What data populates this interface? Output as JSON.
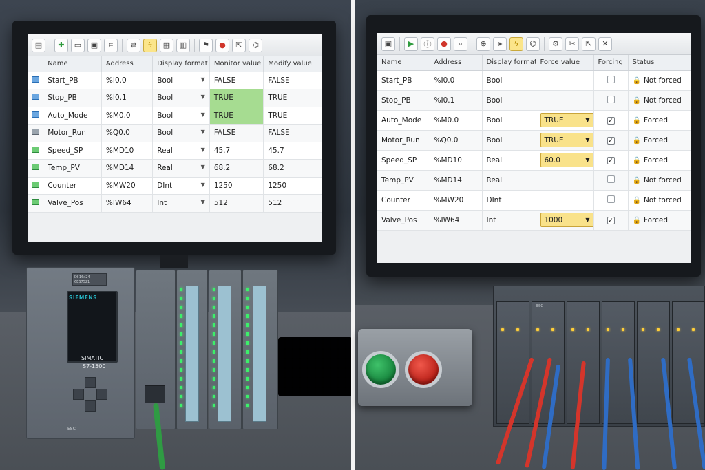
{
  "left_panel": {
    "toolbar_icons": [
      "new-doc-icon",
      "add-green-icon",
      "open-folder-icon",
      "save-icon",
      "monitor-icon",
      "connect-icon",
      "lightning-icon",
      "table-icon",
      "table-alt-icon",
      "force-icon",
      "stop-icon",
      "export-icon",
      "network-icon"
    ],
    "columns": [
      "Name",
      "Address",
      "Display format",
      "Monitor value",
      "Modify value"
    ],
    "rows": [
      {
        "name": "Start_PB",
        "address": "%I0.0",
        "format": "Bool",
        "monitor": "FALSE",
        "modify": "FALSE",
        "icon": "blue",
        "highlight": false
      },
      {
        "name": "Stop_PB",
        "address": "%I0.1",
        "format": "Bool",
        "monitor": "TRUE",
        "modify": "TRUE",
        "icon": "blue",
        "highlight": true
      },
      {
        "name": "Auto_Mode",
        "address": "%M0.0",
        "format": "Bool",
        "monitor": "TRUE",
        "modify": "TRUE",
        "icon": "blue",
        "highlight": true
      },
      {
        "name": "Motor_Run",
        "address": "%Q0.0",
        "format": "Bool",
        "monitor": "FALSE",
        "modify": "FALSE",
        "icon": "gray",
        "highlight": false
      },
      {
        "name": "Speed_SP",
        "address": "%MD10",
        "format": "Real",
        "monitor": "45.7",
        "modify": "45.7",
        "icon": "green",
        "highlight": false
      },
      {
        "name": "Temp_PV",
        "address": "%MD14",
        "format": "Real",
        "monitor": "68.2",
        "modify": "68.2",
        "icon": "green",
        "highlight": false
      },
      {
        "name": "Counter",
        "address": "%MW20",
        "format": "DInt",
        "monitor": "1250",
        "modify": "1250",
        "icon": "green",
        "highlight": false
      },
      {
        "name": "Valve_Pos",
        "address": "%IW64",
        "format": "Int",
        "monitor": "512",
        "modify": "512",
        "icon": "green",
        "highlight": false
      }
    ]
  },
  "right_panel": {
    "toolbar_icons": [
      "save-icon",
      "run-icon",
      "info-icon",
      "stop-record-icon",
      "search-doc-icon",
      "zoom-icon",
      "run-man-icon",
      "lightning-icon",
      "network-icon",
      "settings-doc-icon",
      "cut-icon",
      "export-icon",
      "tools-icon"
    ],
    "columns": [
      "Name",
      "Address",
      "Display format",
      "Force value",
      "Forcing",
      "Status"
    ],
    "rows": [
      {
        "name": "Start_PB",
        "address": "%I0.0",
        "format": "Bool",
        "force": "",
        "forcing": false,
        "status": "Not forced"
      },
      {
        "name": "Stop_PB",
        "address": "%I0.1",
        "format": "Bool",
        "force": "",
        "forcing": false,
        "status": "Not forced"
      },
      {
        "name": "Auto_Mode",
        "address": "%M0.0",
        "format": "Bool",
        "force": "TRUE",
        "forcing": true,
        "status": "Forced"
      },
      {
        "name": "Motor_Run",
        "address": "%Q0.0",
        "format": "Bool",
        "force": "TRUE",
        "forcing": true,
        "status": "Forced"
      },
      {
        "name": "Speed_SP",
        "address": "%MD10",
        "format": "Real",
        "force": "60.0",
        "forcing": true,
        "status": "Forced"
      },
      {
        "name": "Temp_PV",
        "address": "%MD14",
        "format": "Real",
        "force": "",
        "forcing": false,
        "status": "Not forced"
      },
      {
        "name": "Counter",
        "address": "%MW20",
        "format": "DInt",
        "force": "",
        "forcing": false,
        "status": "Not forced"
      },
      {
        "name": "Valve_Pos",
        "address": "%IW64",
        "format": "Int",
        "force": "1000",
        "forcing": true,
        "status": "Forced"
      }
    ]
  },
  "hardware": {
    "cpu_brand": "SIEMENS",
    "cpu_label_1": "SIMATIC",
    "cpu_label_2": "S7-1500",
    "cpu_esc": "ESC",
    "cpu_top_label_1": "DI 16x24",
    "cpu_top_label_2": "6ES7521",
    "rack_label": "ESC"
  },
  "colors": {
    "highlight_green": "#a6dc91",
    "force_yellow": "#f9e28a",
    "led_green": "#3cf06a",
    "cable_red": "#d4352b",
    "cable_blue": "#2f6cc4"
  }
}
